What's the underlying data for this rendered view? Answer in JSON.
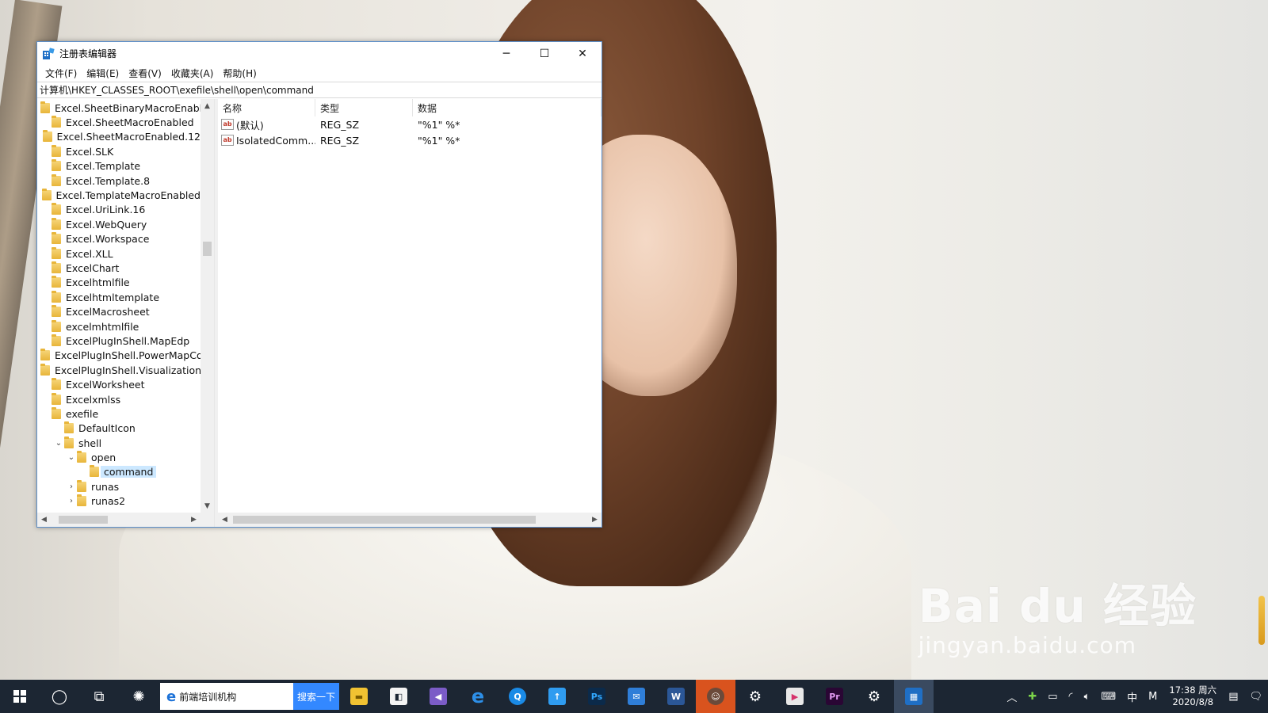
{
  "window": {
    "title": "注册表编辑器",
    "controls": {
      "minimize": "─",
      "maximize": "☐",
      "close": "✕"
    }
  },
  "menu": [
    "文件(F)",
    "编辑(E)",
    "查看(V)",
    "收藏夹(A)",
    "帮助(H)"
  ],
  "address": "计算机\\HKEY_CLASSES_ROOT\\exefile\\shell\\open\\command",
  "tree": [
    {
      "label": "Excel.SheetBinaryMacroEnable",
      "level": 0,
      "expander": ""
    },
    {
      "label": "Excel.SheetMacroEnabled",
      "level": 0,
      "expander": ""
    },
    {
      "label": "Excel.SheetMacroEnabled.12",
      "level": 0,
      "expander": ""
    },
    {
      "label": "Excel.SLK",
      "level": 0,
      "expander": ""
    },
    {
      "label": "Excel.Template",
      "level": 0,
      "expander": ""
    },
    {
      "label": "Excel.Template.8",
      "level": 0,
      "expander": ""
    },
    {
      "label": "Excel.TemplateMacroEnabled",
      "level": 0,
      "expander": ""
    },
    {
      "label": "Excel.UriLink.16",
      "level": 0,
      "expander": ""
    },
    {
      "label": "Excel.WebQuery",
      "level": 0,
      "expander": ""
    },
    {
      "label": "Excel.Workspace",
      "level": 0,
      "expander": ""
    },
    {
      "label": "Excel.XLL",
      "level": 0,
      "expander": ""
    },
    {
      "label": "ExcelChart",
      "level": 0,
      "expander": ""
    },
    {
      "label": "Excelhtmlfile",
      "level": 0,
      "expander": ""
    },
    {
      "label": "Excelhtmltemplate",
      "level": 0,
      "expander": ""
    },
    {
      "label": "ExcelMacrosheet",
      "level": 0,
      "expander": ""
    },
    {
      "label": "excelmhtmlfile",
      "level": 0,
      "expander": ""
    },
    {
      "label": "ExcelPlugInShell.MapEdp",
      "level": 0,
      "expander": ""
    },
    {
      "label": "ExcelPlugInShell.PowerMapCor",
      "level": 0,
      "expander": ""
    },
    {
      "label": "ExcelPlugInShell.VisualizationLc",
      "level": 0,
      "expander": ""
    },
    {
      "label": "ExcelWorksheet",
      "level": 0,
      "expander": ""
    },
    {
      "label": "Excelxmlss",
      "level": 0,
      "expander": ""
    },
    {
      "label": "exefile",
      "level": 0,
      "expander": ""
    },
    {
      "label": "DefaultIcon",
      "level": 1,
      "expander": ""
    },
    {
      "label": "shell",
      "level": 1,
      "expander": "v"
    },
    {
      "label": "open",
      "level": 2,
      "expander": "v"
    },
    {
      "label": "command",
      "level": 3,
      "expander": "",
      "selected": true
    },
    {
      "label": "runas",
      "level": 2,
      "expander": ">"
    },
    {
      "label": "runas2",
      "level": 2,
      "expander": ">"
    }
  ],
  "list": {
    "headers": {
      "name": "名称",
      "type": "类型",
      "data": "数据"
    },
    "rows": [
      {
        "name": "(默认)",
        "type": "REG_SZ",
        "data": "\"%1\" %*"
      },
      {
        "name": "IsolatedComm...",
        "type": "REG_SZ",
        "data": "\"%1\" %*"
      }
    ]
  },
  "taskbar": {
    "ie_text": "前端培训机构",
    "search_btn": "搜索一下",
    "apps": [
      "explorer",
      "store",
      "visual-studio",
      "edge",
      "browser",
      "thunder",
      "Ps",
      "outlook",
      "W",
      "avatar-app",
      "settings",
      "media",
      "Pr",
      "control-panel",
      "registry-editor"
    ],
    "ps_label": "Ps",
    "word_label": "W",
    "pr_label": "Pr",
    "tray": {
      "ime": "中",
      "m": "M"
    },
    "clock": {
      "time": "17:38 周六",
      "date": "2020/8/8"
    }
  },
  "watermark": {
    "main": "Bai du 经验",
    "sub": "jingyan.baidu.com"
  },
  "colors": {
    "taskbar": "#1c2633",
    "selection": "#cce8ff",
    "active_app": "#d9531e",
    "search_button": "#3388ff"
  }
}
